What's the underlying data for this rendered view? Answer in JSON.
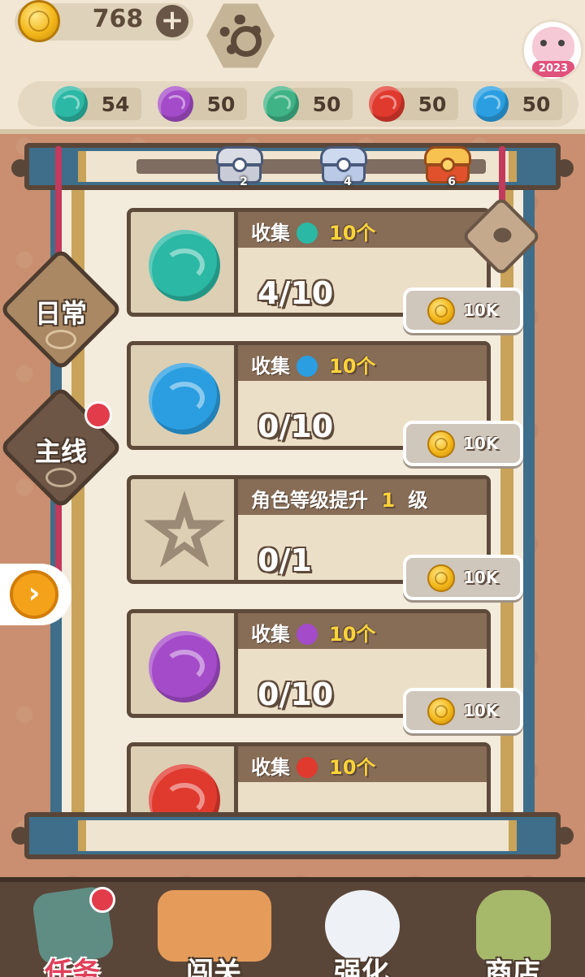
{
  "currency": {
    "coins": "768",
    "plus_label": "+"
  },
  "avatar": {
    "badge": "2023"
  },
  "resources": [
    {
      "icon": "cloud-orb-icon",
      "color": "#2bb8a4",
      "value": "54"
    },
    {
      "icon": "wind-orb-icon",
      "color": "#a44bc9",
      "value": "50"
    },
    {
      "icon": "leaf-orb-icon",
      "color": "#3fb385",
      "value": "50"
    },
    {
      "icon": "fire-orb-icon",
      "color": "#e0392e",
      "value": "50"
    },
    {
      "icon": "water-orb-icon",
      "color": "#2a9ee0",
      "value": "50"
    }
  ],
  "chest_track": {
    "chests": [
      {
        "count": "2",
        "color": "#c9ccd6"
      },
      {
        "count": "4",
        "color": "#b9c9e6"
      },
      {
        "count": "6",
        "color": "#f2a53a"
      }
    ]
  },
  "tabs": [
    {
      "label": "日常",
      "active": true
    },
    {
      "label": "主线",
      "active": false,
      "has_notification": true
    }
  ],
  "tasks": [
    {
      "title": "收集",
      "orb_color": "#2bb8a4",
      "amount": "10个",
      "progress": "4/10",
      "reward": "10K"
    },
    {
      "title": "收集",
      "orb_color": "#2a9ee0",
      "amount": "10个",
      "progress": "0/10",
      "reward": "10K"
    },
    {
      "title": "角色等级提升",
      "orb_color": "",
      "amount": "1",
      "unit": "级",
      "progress": "0/1",
      "reward": "10K"
    },
    {
      "title": "收集",
      "orb_color": "#a44bc9",
      "amount": "10个",
      "progress": "0/10",
      "reward": "10K"
    },
    {
      "title": "收集",
      "orb_color": "#e0392e",
      "amount": "10个",
      "progress": "",
      "reward": ""
    }
  ],
  "bottom_nav": [
    {
      "label": "任务",
      "active": true,
      "has_notification": true
    },
    {
      "label": "闯关",
      "active": false
    },
    {
      "label": "强化",
      "active": false
    },
    {
      "label": "商店",
      "active": false
    }
  ],
  "colors": {
    "background": "#c98f70",
    "panel_cream": "#f3ebdb",
    "scroll_blue": "#3e6e8a",
    "wood_dark": "#5a4638",
    "gold": "#f3b71a"
  }
}
